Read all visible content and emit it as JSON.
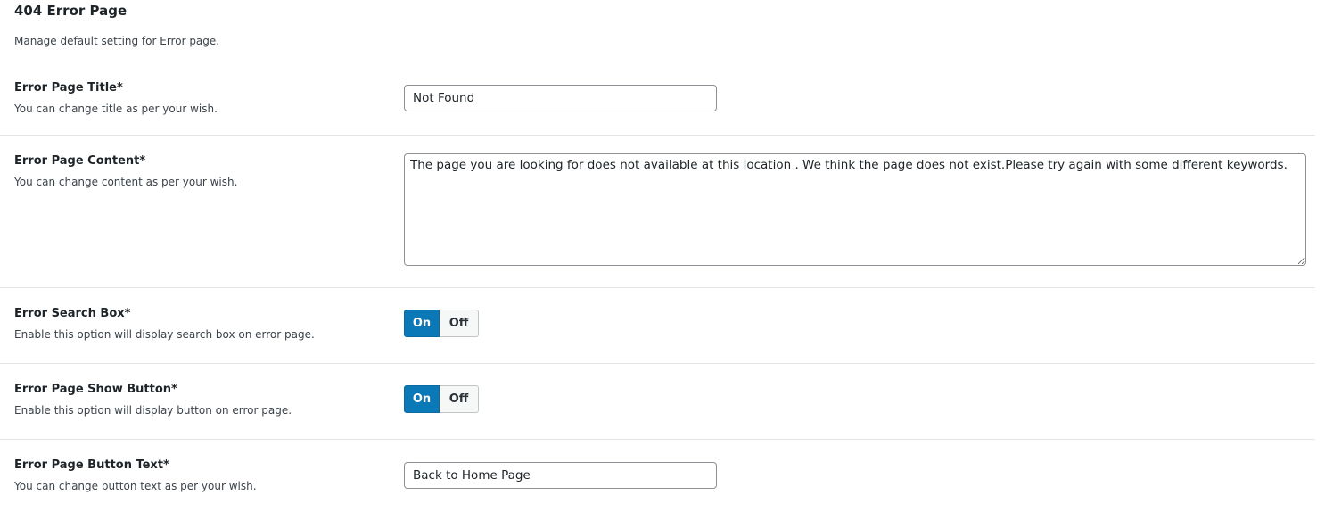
{
  "header": {
    "title": "404 Error Page",
    "description": "Manage default setting for Error page."
  },
  "fields": {
    "title": {
      "label": "Error Page Title*",
      "help": "You can change title as per your wish.",
      "value": "Not Found"
    },
    "content": {
      "label": "Error Page Content*",
      "help": "You can change content as per your wish.",
      "value": "The page you are looking for does not available at this location . We think the page does not exist.Please try again with some different keywords."
    },
    "search_box": {
      "label": "Error Search Box*",
      "help": "Enable this option will display search box on error page.",
      "on_label": "On",
      "off_label": "Off",
      "selected": "On"
    },
    "show_button": {
      "label": "Error Page Show Button*",
      "help": "Enable this option will display button on error page.",
      "on_label": "On",
      "off_label": "Off",
      "selected": "On"
    },
    "button_text": {
      "label": "Error Page Button Text*",
      "help": "You can change button text as per your wish.",
      "value": "Back to Home Page"
    }
  },
  "colors": {
    "toggle_active": "#0b79b8",
    "toggle_inactive": "#f6f7f7",
    "divider": "#e2e4e7"
  }
}
